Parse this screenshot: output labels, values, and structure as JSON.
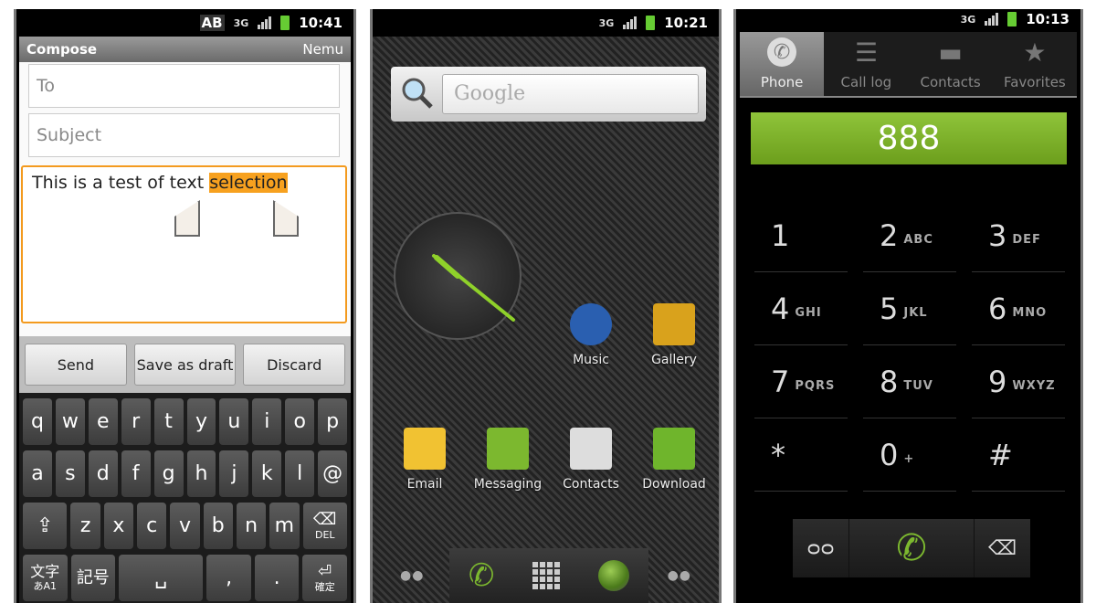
{
  "compose_screen": {
    "status": {
      "ab": "AB",
      "network": "3G",
      "time": "10:41"
    },
    "title": "Compose",
    "menu": "Nemu",
    "to_placeholder": "To",
    "subject_placeholder": "Subject",
    "body_text": "This is a test of text ",
    "body_selected": "selection",
    "buttons": {
      "send": "Send",
      "save_draft": "Save as draft",
      "discard": "Discard"
    },
    "keyboard": {
      "row1": [
        "q",
        "w",
        "e",
        "r",
        "t",
        "y",
        "u",
        "i",
        "o",
        "p"
      ],
      "row2": [
        "a",
        "s",
        "d",
        "f",
        "g",
        "h",
        "j",
        "k",
        "l",
        "@"
      ],
      "row3": [
        "z",
        "x",
        "c",
        "v",
        "b",
        "n",
        "m"
      ],
      "shift": "⇪",
      "del_icon": "⌫",
      "del": "DEL",
      "mode": "文字",
      "mode_sub": "あA1",
      "symbols": "記号",
      "space": "␣",
      "comma": ",",
      "period": ".",
      "enter_icon": "⏎",
      "enter": "確定"
    }
  },
  "home_screen": {
    "status": {
      "network": "3G",
      "time": "10:21"
    },
    "search_placeholder": "Google",
    "apps": [
      {
        "label": "Music",
        "color": "#2a5fb0"
      },
      {
        "label": "Gallery",
        "color": "#d9a21c"
      },
      {
        "label": "Email",
        "color": "#f1c232"
      },
      {
        "label": "Messaging",
        "color": "#7cb82f"
      },
      {
        "label": "Contacts",
        "color": "#dddddd"
      },
      {
        "label": "Download",
        "color": "#6fb52c"
      }
    ],
    "dock": {
      "phone_icon": "phone-icon",
      "apps_icon": "grid-icon",
      "browser_icon": "globe-icon"
    }
  },
  "dialer_screen": {
    "status": {
      "network": "3G",
      "time": "10:13"
    },
    "tabs": [
      {
        "label": "Phone",
        "icon": "✆",
        "active": true
      },
      {
        "label": "Call log",
        "icon": "☰"
      },
      {
        "label": "Contacts",
        "icon": "▬"
      },
      {
        "label": "Favorites",
        "icon": "★"
      }
    ],
    "number": "888",
    "keys": [
      [
        "1",
        ""
      ],
      [
        "2",
        "ABC"
      ],
      [
        "3",
        "DEF"
      ],
      [
        "4",
        "GHI"
      ],
      [
        "5",
        "JKL"
      ],
      [
        "6",
        "MNO"
      ],
      [
        "7",
        "PQRS"
      ],
      [
        "8",
        "TUV"
      ],
      [
        "9",
        "WXYZ"
      ],
      [
        "*",
        ""
      ],
      [
        "0",
        "+"
      ],
      [
        "#",
        ""
      ]
    ],
    "voicemail_icon": "ᴑᴑ",
    "call_icon": "✆",
    "backspace_icon": "⌫",
    "accent": "#7cb82f"
  }
}
